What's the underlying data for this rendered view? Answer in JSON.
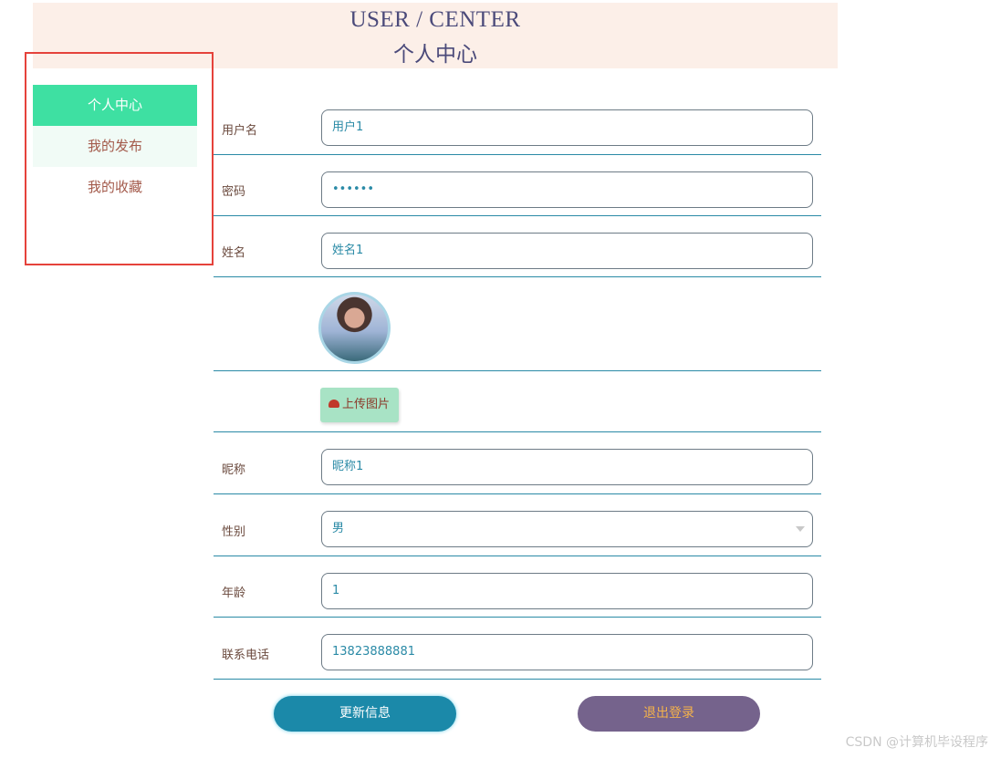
{
  "header": {
    "title_en": "USER / CENTER",
    "title_zh": "个人中心"
  },
  "sidebar": {
    "items": [
      {
        "label": "个人中心",
        "active": true
      },
      {
        "label": "我的发布",
        "active": false
      },
      {
        "label": "我的收藏",
        "active": false
      }
    ]
  },
  "form": {
    "username": {
      "label": "用户名",
      "value": "用户1"
    },
    "password": {
      "label": "密码",
      "value": "••••••"
    },
    "name": {
      "label": "姓名",
      "value": "姓名1"
    },
    "upload": {
      "label": "上传图片",
      "icon": "cloud-upload-icon"
    },
    "nickname": {
      "label": "昵称",
      "value": "昵称1"
    },
    "gender": {
      "label": "性别",
      "value": "男"
    },
    "age": {
      "label": "年龄",
      "value": "1"
    },
    "phone": {
      "label": "联系电话",
      "value": "13823888881"
    }
  },
  "buttons": {
    "update": "更新信息",
    "logout": "退出登录"
  },
  "watermark": "CSDN @计算机毕设程序"
}
